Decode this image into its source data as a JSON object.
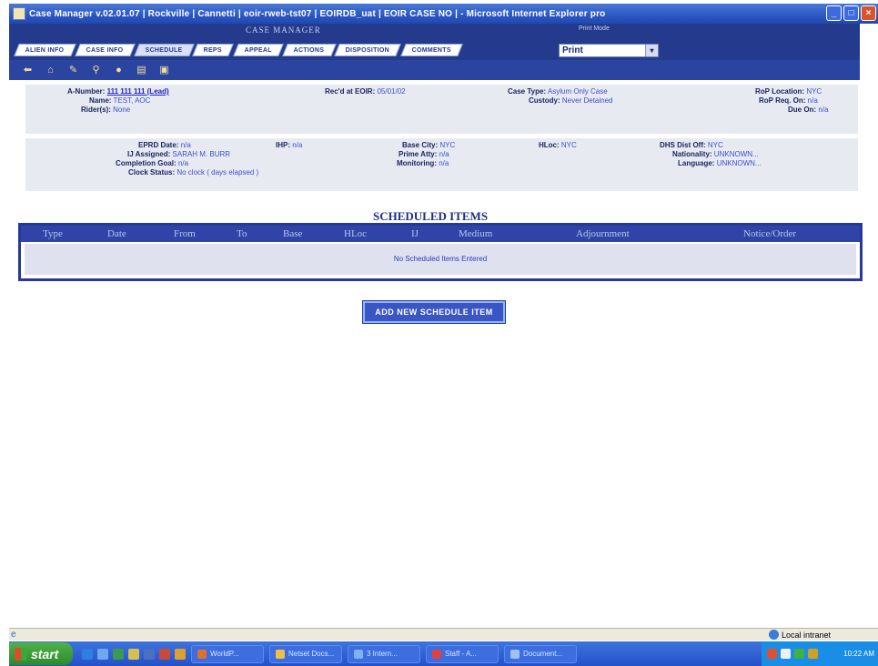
{
  "window": {
    "title": "Case Manager v.02.01.07 | Rockville | Cannetti | eoir-rweb-tst07 | EOIRDB_uat | EOIR CASE NO | - Microsoft Internet Explorer pro"
  },
  "banner": {
    "app_name": "CASE MANAGER",
    "print_mode_label": "Print Mode",
    "print_mode_value": "Print"
  },
  "tabs": [
    {
      "label": "Alien Info"
    },
    {
      "label": "Case Info"
    },
    {
      "label": "Schedule"
    },
    {
      "label": "Reps"
    },
    {
      "label": "Appeal"
    },
    {
      "label": "Actions"
    },
    {
      "label": "Disposition"
    },
    {
      "label": "Comments"
    }
  ],
  "toolbar_icons": [
    "back-arrow-icon",
    "home-icon",
    "edit-icon",
    "search-icon",
    "lightbulb-icon",
    "notepad-icon",
    "document-icon"
  ],
  "case": {
    "a_number_label": "A-Number:",
    "a_number_value": "111 111 111 (Lead)",
    "name_label": "Name:",
    "name_value": "TEST, AOC",
    "riders_label": "Rider(s):",
    "riders_value": "None",
    "recd_eoir_label": "Rec'd at EOIR:",
    "recd_eoir_value": "05/01/02",
    "case_type_label": "Case Type:",
    "case_type_value": "Asylum Only Case",
    "custody_label": "Custody:",
    "custody_value": "Never Detained",
    "rop_location_label": "RoP Location:",
    "rop_location_value": "NYC",
    "rop_req_label": "RoP Req. On:",
    "rop_req_value": "n/a",
    "due_on_label": "Due On:",
    "due_on_value": "n/a"
  },
  "detail": {
    "eprd_label": "EPRD Date:",
    "eprd_value": "n/a",
    "ihp_label": "IHP:",
    "ihp_value": "n/a",
    "ij_label": "IJ Assigned:",
    "ij_value": "SARAH M. BURR",
    "completion_label": "Completion Goal:",
    "completion_value": "n/a",
    "clock_label": "Clock Status:",
    "clock_value": "No clock  ( days elapsed )",
    "base_city_label": "Base City:",
    "base_city_value": "NYC",
    "prime_atty_label": "Prime Atty:",
    "prime_atty_value": "n/a",
    "monitoring_label": "Monitoring:",
    "monitoring_value": "n/a",
    "hloc_label": "HLoc:",
    "hloc_value": "NYC",
    "dhs_label": "DHS Dist Off:",
    "dhs_value": "NYC",
    "nationality_label": "Nationality:",
    "nationality_value": "UNKNOWN...",
    "language_label": "Language:",
    "language_value": "UNKNOWN..."
  },
  "schedule": {
    "title": "SCHEDULED ITEMS",
    "columns": [
      "Type",
      "Date",
      "From",
      "To",
      "Base",
      "HLoc",
      "IJ",
      "Medium",
      "Adjournment",
      "Notice/Order"
    ],
    "empty_message": "No Scheduled Items Entered",
    "add_button": "Add New Schedule Item"
  },
  "statusbar": {
    "zone": "Local intranet"
  },
  "taskbar": {
    "start": "start",
    "tasks": [
      "WorldP...",
      "Netset Docs...",
      "3 Intern...",
      "Staff - A...",
      "Document..."
    ],
    "clock": "10:22 AM"
  }
}
